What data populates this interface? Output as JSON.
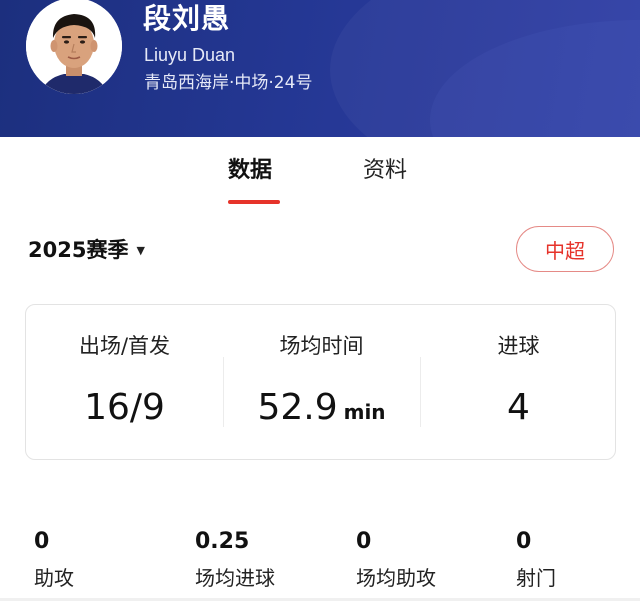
{
  "header": {
    "name_cn": "段刘愚",
    "name_en": "Liuyu Duan",
    "info": "青岛西海岸·中场·24号",
    "bg_color": "#243793"
  },
  "tabs": [
    {
      "label": "数据",
      "active": true
    },
    {
      "label": "资料",
      "active": false
    }
  ],
  "season": {
    "label": "2025赛季",
    "icon": "caret-down-icon"
  },
  "league_button": {
    "label": "中超",
    "accent": "#e6332a"
  },
  "stats_card": [
    {
      "label": "出场/首发",
      "value": "16/9",
      "unit": ""
    },
    {
      "label": "场均时间",
      "value": "52.9",
      "unit": "min"
    },
    {
      "label": "进球",
      "value": "4",
      "unit": ""
    }
  ],
  "mini_stats": [
    {
      "value": "0",
      "label": "助攻"
    },
    {
      "value": "0.25",
      "label": "场均进球"
    },
    {
      "value": "0",
      "label": "场均助攻"
    },
    {
      "value": "0",
      "label": "射门"
    }
  ]
}
